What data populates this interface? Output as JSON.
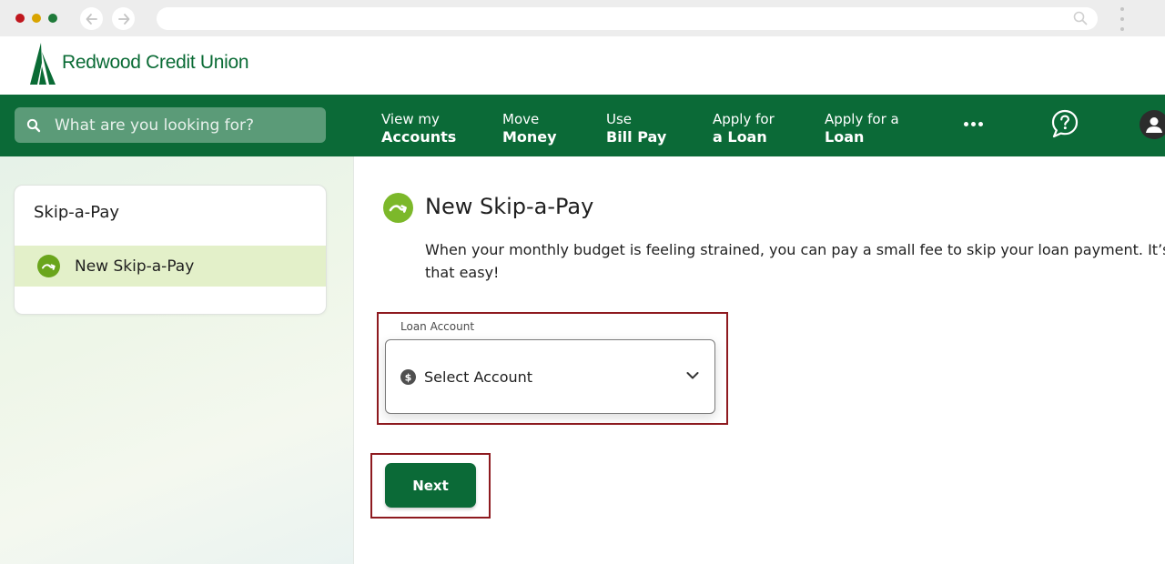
{
  "browser": {
    "dot_colors": [
      "#c0171e",
      "#d9a400",
      "#1f7a3a"
    ],
    "back_icon": "arrow-left-icon",
    "forward_icon": "arrow-right-icon",
    "search_icon": "search-icon",
    "menu_icon": "kebab-menu-icon"
  },
  "brand": {
    "name": "Redwood Credit Union",
    "color": "#0a6b35"
  },
  "nav": {
    "search_placeholder": "What are you looking for?",
    "items": [
      {
        "line1": "View my",
        "line2": "Accounts"
      },
      {
        "line1": "Move",
        "line2": "Money"
      },
      {
        "line1": "Use",
        "line2": "Bill Pay"
      },
      {
        "line1": "Apply for",
        "line2": "a Loan"
      },
      {
        "line1": "Apply for a",
        "line2": "Loan"
      }
    ],
    "more_icon": "more-horizontal-icon",
    "help_icon": "help-chat-icon",
    "profile_icon": "user-avatar-icon",
    "background": "#0b6a37"
  },
  "sidebar": {
    "title": "Skip-a-Pay",
    "items": [
      {
        "label": "New Skip-a-Pay",
        "icon": "skip-arrow-icon",
        "selected": true
      }
    ]
  },
  "main": {
    "title": "New Skip-a-Pay",
    "description": "When your monthly budget is feeling strained, you can pay a small fee to skip your loan payment. It’s that easy!",
    "loan_account": {
      "label": "Loan Account",
      "value": "Select Account",
      "icon": "dollar-icon"
    },
    "next_label": "Next",
    "highlight_color": "#8e1a1f"
  }
}
